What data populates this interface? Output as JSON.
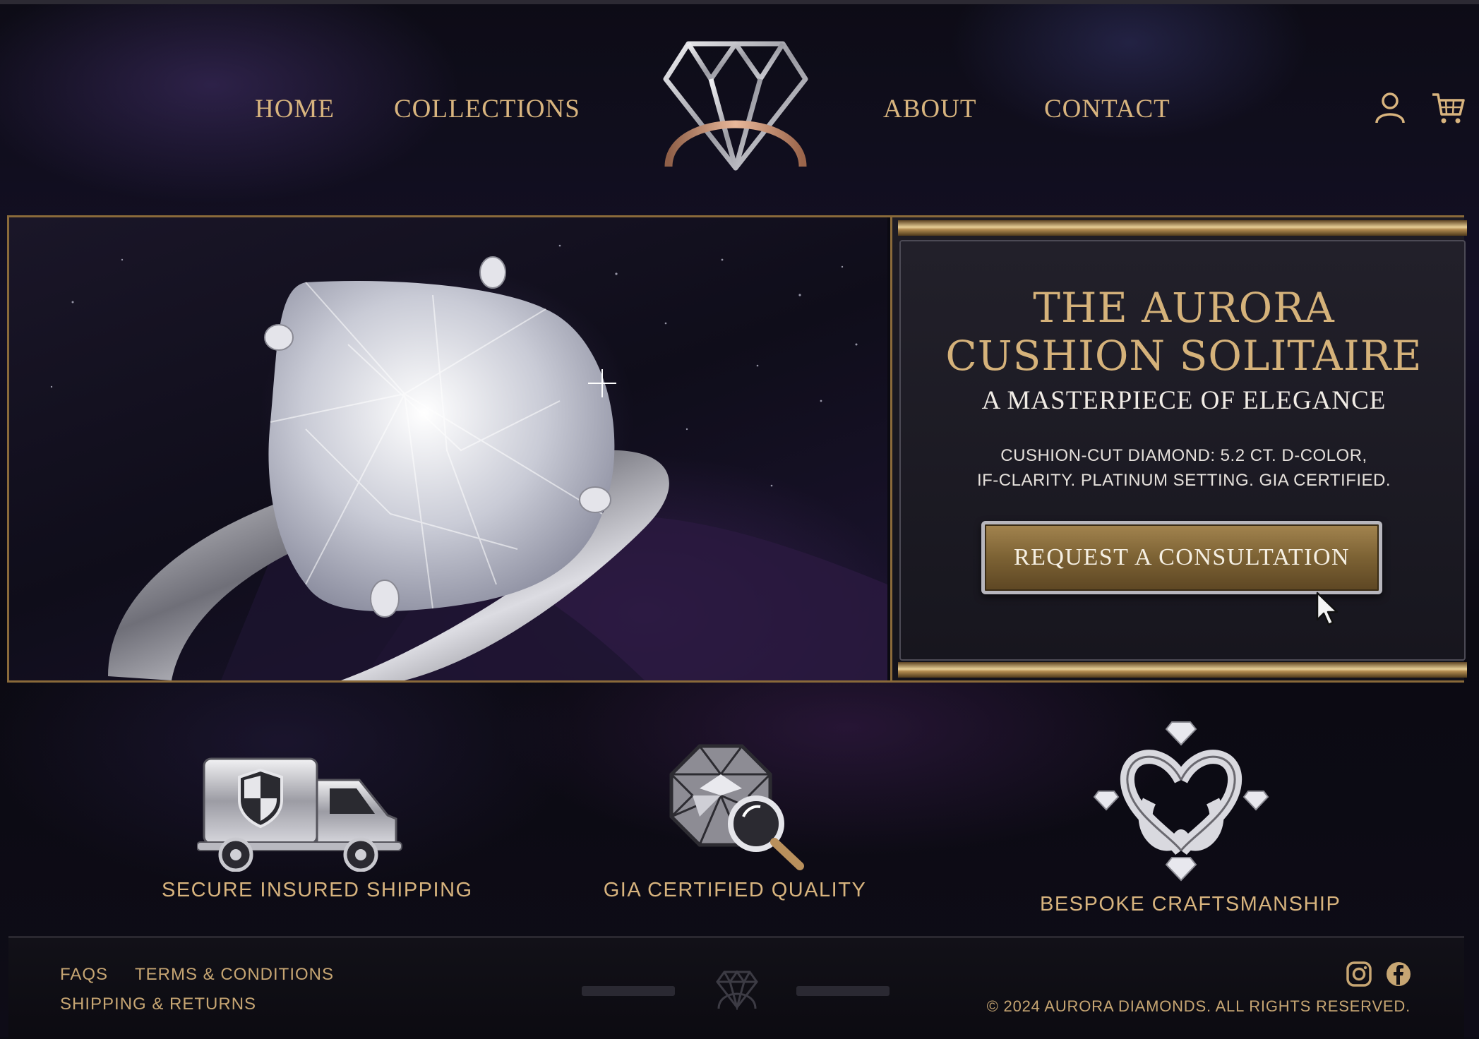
{
  "nav": {
    "links": [
      {
        "label": "HOME"
      },
      {
        "label": "COLLECTIONS"
      },
      {
        "label": "ABOUT"
      },
      {
        "label": "CONTACT"
      }
    ],
    "account_icon": "user-icon",
    "cart_icon": "cart-icon",
    "logo_icon": "diamond-ring-logo"
  },
  "hero": {
    "title_line1": "THE AURORA",
    "title_line2": "CUSHION SOLITAIRE",
    "subtitle": "A MASTERPIECE OF ELEGANCE",
    "description_line1": "CUSHION-CUT DIAMOND: 5.2 CT. D-COLOR,",
    "description_line2": "IF-CLARITY. PLATINUM SETTING. GIA CERTIFIED.",
    "cta_label": "REQUEST A CONSULTATION"
  },
  "features": [
    {
      "label": "SECURE INSURED SHIPPING",
      "icon": "shipping-truck-icon"
    },
    {
      "label": "GIA CERTIFIED QUALITY",
      "icon": "diamond-magnifier-icon"
    },
    {
      "label": "BESPOKE CRAFTSMANSHIP",
      "icon": "interlaced-hearts-icon"
    }
  ],
  "footer": {
    "links": [
      {
        "label": "FAQS"
      },
      {
        "label": "TERMS & CONDITIONS"
      },
      {
        "label": "SHIPPING & RETURNS"
      }
    ],
    "copyright": "© 2024 AURORA DIAMONDS. ALL RIGHTS RESERVED.",
    "social_icons": [
      "instagram-icon",
      "facebook-icon"
    ]
  },
  "colors": {
    "gold": "#d8b47e",
    "background": "#0c0b14",
    "button": "#7c6234"
  }
}
